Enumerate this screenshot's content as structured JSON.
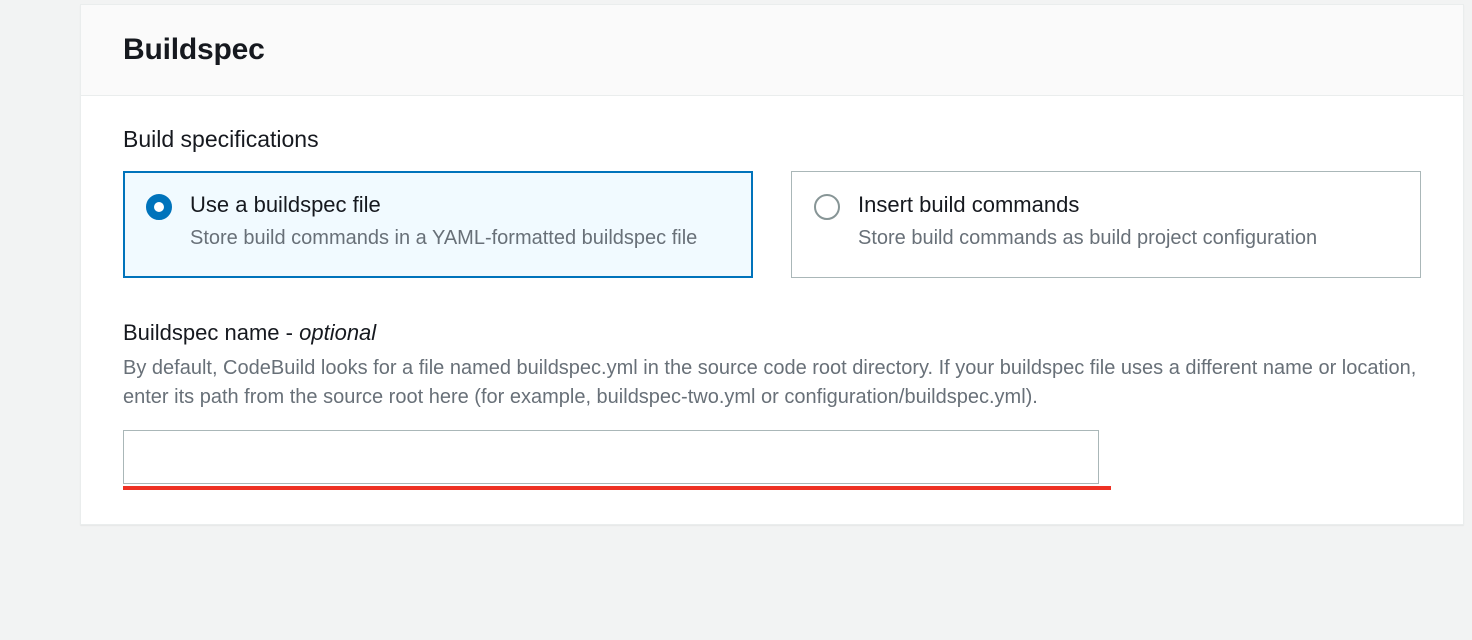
{
  "panel": {
    "title": "Buildspec"
  },
  "section": {
    "build_specifications_label": "Build specifications",
    "options": {
      "use_file": {
        "title": "Use a buildspec file",
        "desc": "Store build commands in a YAML-formatted buildspec file"
      },
      "insert_cmds": {
        "title": "Insert build commands",
        "desc": "Store build commands as build project configuration"
      }
    }
  },
  "buildspec_name": {
    "label_prefix": "Buildspec name ",
    "label_dash": "- ",
    "label_optional": "optional",
    "help": "By default, CodeBuild looks for a file named buildspec.yml in the source code root directory. If your buildspec file uses a different name or location, enter its path from the source root here (for example, buildspec-two.yml or configuration/buildspec.yml).",
    "value": ""
  }
}
